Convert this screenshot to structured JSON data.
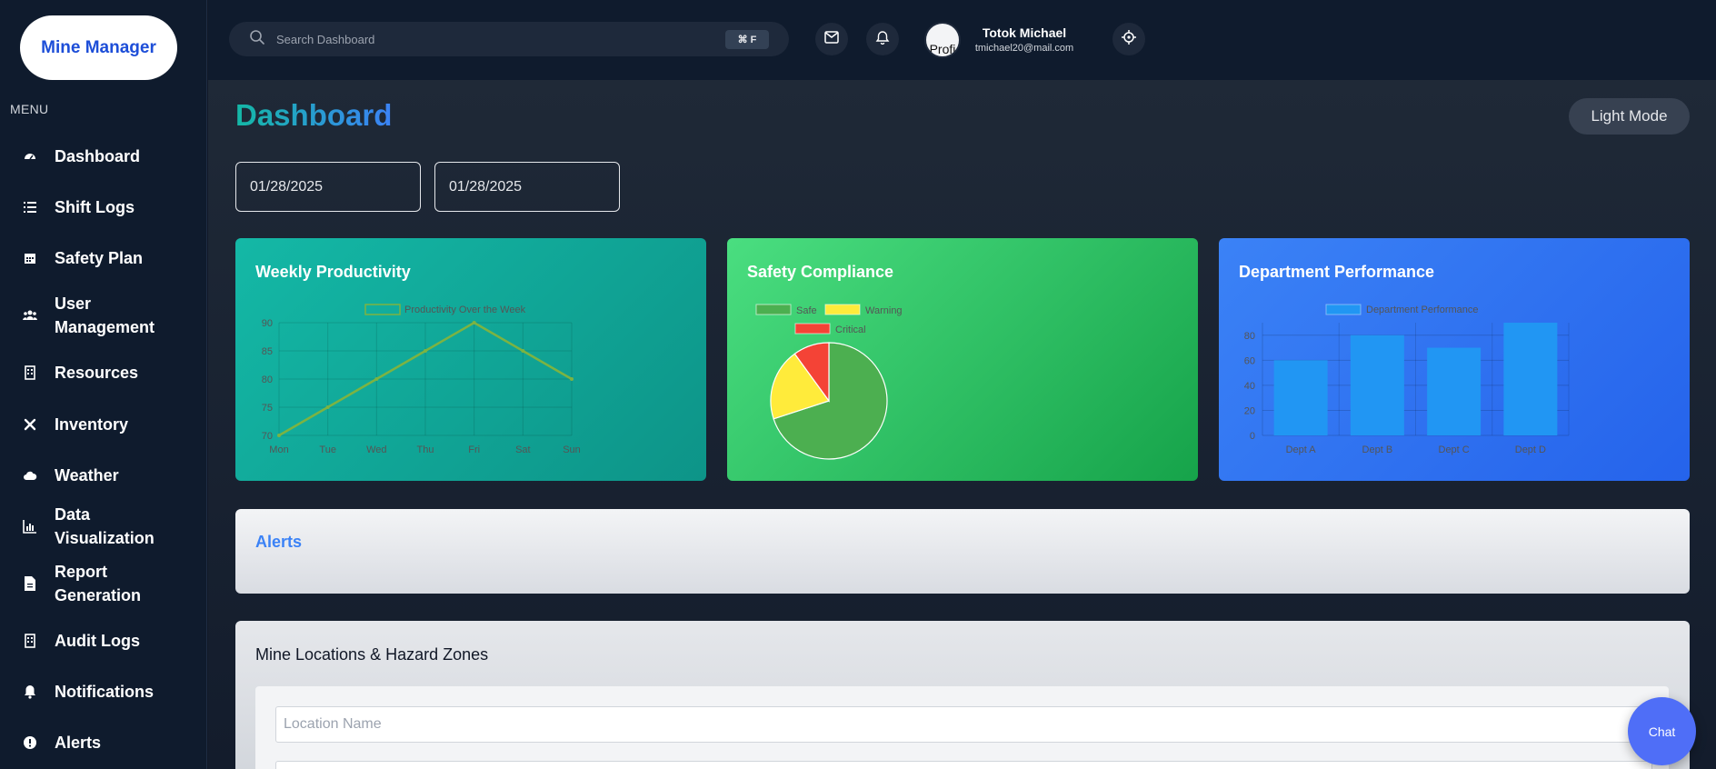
{
  "brand": {
    "name": "Mine Manager"
  },
  "sidebar": {
    "menu_label": "MENU",
    "items": [
      {
        "label": "Dashboard",
        "icon": "gauge-icon"
      },
      {
        "label": "Shift Logs",
        "icon": "list-icon"
      },
      {
        "label": "Safety Plan",
        "icon": "calendar-icon"
      },
      {
        "label": "User Management",
        "icon": "users-icon"
      },
      {
        "label": "Resources",
        "icon": "building-icon"
      },
      {
        "label": "Inventory",
        "icon": "tools-icon"
      },
      {
        "label": "Weather",
        "icon": "cloud-icon"
      },
      {
        "label": "Data Visualization",
        "icon": "chart-icon"
      },
      {
        "label": "Report Generation",
        "icon": "file-icon"
      },
      {
        "label": "Audit Logs",
        "icon": "building-icon"
      },
      {
        "label": "Notifications",
        "icon": "bell-icon"
      },
      {
        "label": "Alerts",
        "icon": "alert-icon"
      }
    ]
  },
  "topbar": {
    "search_placeholder": "Search Dashboard",
    "shortcut": "⌘ F",
    "user_name": "Totok Michael",
    "user_email": "tmichael20@mail.com",
    "avatar_alt": "Profi"
  },
  "main": {
    "title": "Dashboard",
    "theme_toggle": "Light Mode",
    "start_date": "01/28/2025",
    "end_date": "01/28/2025",
    "alerts_title": "Alerts",
    "map_title": "Mine Locations & Hazard Zones",
    "location_placeholder": "Location Name",
    "chat_label": "Chat"
  },
  "colors": {
    "sidebar_bg": "#0f1b2d",
    "card1": "#14b8a6",
    "card2": "#22c55e",
    "card3": "#3b82f6",
    "safe": "#4caf50",
    "warning": "#ffeb3b",
    "critical": "#f44336",
    "dept_bar": "#2196f3"
  },
  "cards": {
    "productivity_title": "Weekly Productivity",
    "safety_title": "Safety Compliance",
    "department_title": "Department Performance"
  },
  "chart_data": [
    {
      "type": "line",
      "title": "Weekly Productivity",
      "legend": "Productivity Over the Week",
      "categories": [
        "Mon",
        "Tue",
        "Wed",
        "Thu",
        "Fri",
        "Sat",
        "Sun"
      ],
      "series": [
        {
          "name": "Productivity Over the Week",
          "values": [
            70,
            75,
            80,
            85,
            90,
            85,
            80
          ]
        }
      ],
      "ylim": [
        70,
        90
      ],
      "yticks": [
        70,
        75,
        80,
        85,
        90
      ],
      "grid": true,
      "legend_position": "top"
    },
    {
      "type": "pie",
      "title": "Safety Compliance",
      "categories": [
        "Safe",
        "Warning",
        "Critical"
      ],
      "values": [
        70,
        20,
        10
      ],
      "legend_position": "top"
    },
    {
      "type": "bar",
      "title": "Department Performance",
      "legend": "Department Performance",
      "categories": [
        "Dept A",
        "Dept B",
        "Dept C",
        "Dept D"
      ],
      "series": [
        {
          "name": "Department Performance",
          "values": [
            60,
            80,
            70,
            90
          ]
        }
      ],
      "ylim": [
        0,
        90
      ],
      "yticks": [
        0,
        20,
        40,
        60,
        80
      ],
      "grid": true,
      "legend_position": "top"
    }
  ]
}
